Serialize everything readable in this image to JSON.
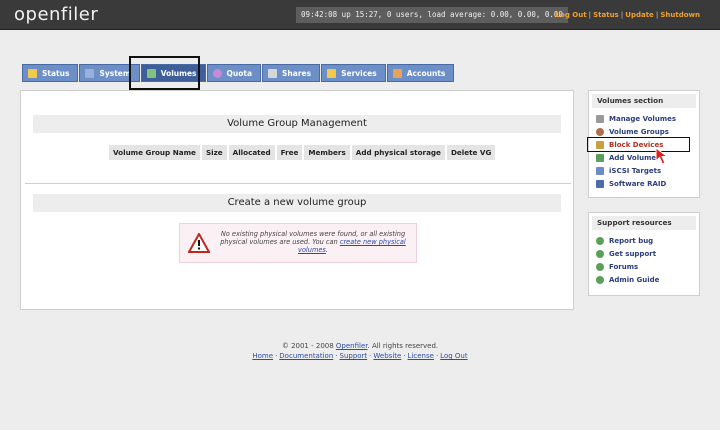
{
  "header": {
    "logo": "openfiler",
    "uptime": "09:42:08 up 15:27, 0 users, load average: 0.00, 0.00, 0.00",
    "links": [
      "Log Out",
      "Status",
      "Update",
      "Shutdown"
    ]
  },
  "tabs": [
    {
      "label": "Status",
      "icon": "status-icon",
      "color": "#f2c94c"
    },
    {
      "label": "System",
      "icon": "system-icon",
      "color": "#9bb0d8"
    },
    {
      "label": "Volumes",
      "icon": "volumes-icon",
      "color": "#7fc37f",
      "active": true
    },
    {
      "label": "Quota",
      "icon": "quota-icon",
      "color": "#c58ad6"
    },
    {
      "label": "Shares",
      "icon": "shares-icon",
      "color": "#d6d6d6"
    },
    {
      "label": "Services",
      "icon": "services-icon",
      "color": "#f2c94c"
    },
    {
      "label": "Accounts",
      "icon": "accounts-icon",
      "color": "#e6a35a"
    }
  ],
  "main": {
    "vg_title": "Volume Group Management",
    "vg_columns": [
      "Volume Group Name",
      "Size",
      "Allocated",
      "Free",
      "Members",
      "Add physical storage",
      "Delete VG"
    ],
    "create_title": "Create a new volume group",
    "warning_text": "No existing physical volumes were found, or all existing physical volumes are used. You can ",
    "warning_link": "create new physical volumes",
    "warning_end": "."
  },
  "sidebar": {
    "volumes_title": "Volumes section",
    "volumes_items": [
      {
        "label": "Manage Volumes",
        "icon": "manage-volumes-icon",
        "color": "#9a9a9a"
      },
      {
        "label": "Volume Groups",
        "icon": "volume-groups-icon",
        "color": "#b07050"
      },
      {
        "label": "Block Devices",
        "icon": "block-devices-icon",
        "color": "#c8a040"
      },
      {
        "label": "Add Volume",
        "icon": "add-volume-icon",
        "color": "#5aa05a"
      },
      {
        "label": "iSCSI Targets",
        "icon": "iscsi-targets-icon",
        "color": "#6a8ac8"
      },
      {
        "label": "Software RAID",
        "icon": "software-raid-icon",
        "color": "#4a6aa8"
      }
    ],
    "support_title": "Support resources",
    "support_items": [
      {
        "label": "Report bug",
        "icon": "report-bug-icon",
        "color": "#5aa05a"
      },
      {
        "label": "Get support",
        "icon": "get-support-icon",
        "color": "#5aa05a"
      },
      {
        "label": "Forums",
        "icon": "forums-icon",
        "color": "#5aa05a"
      },
      {
        "label": "Admin Guide",
        "icon": "admin-guide-icon",
        "color": "#5aa05a"
      }
    ]
  },
  "footer": {
    "copyright_prefix": "© 2001 - 2008 ",
    "copyright_link": "Openfiler",
    "copyright_suffix": ". All rights reserved.",
    "links": [
      "Home",
      "Documentation",
      "Support",
      "Website",
      "License",
      "Log Out"
    ]
  }
}
